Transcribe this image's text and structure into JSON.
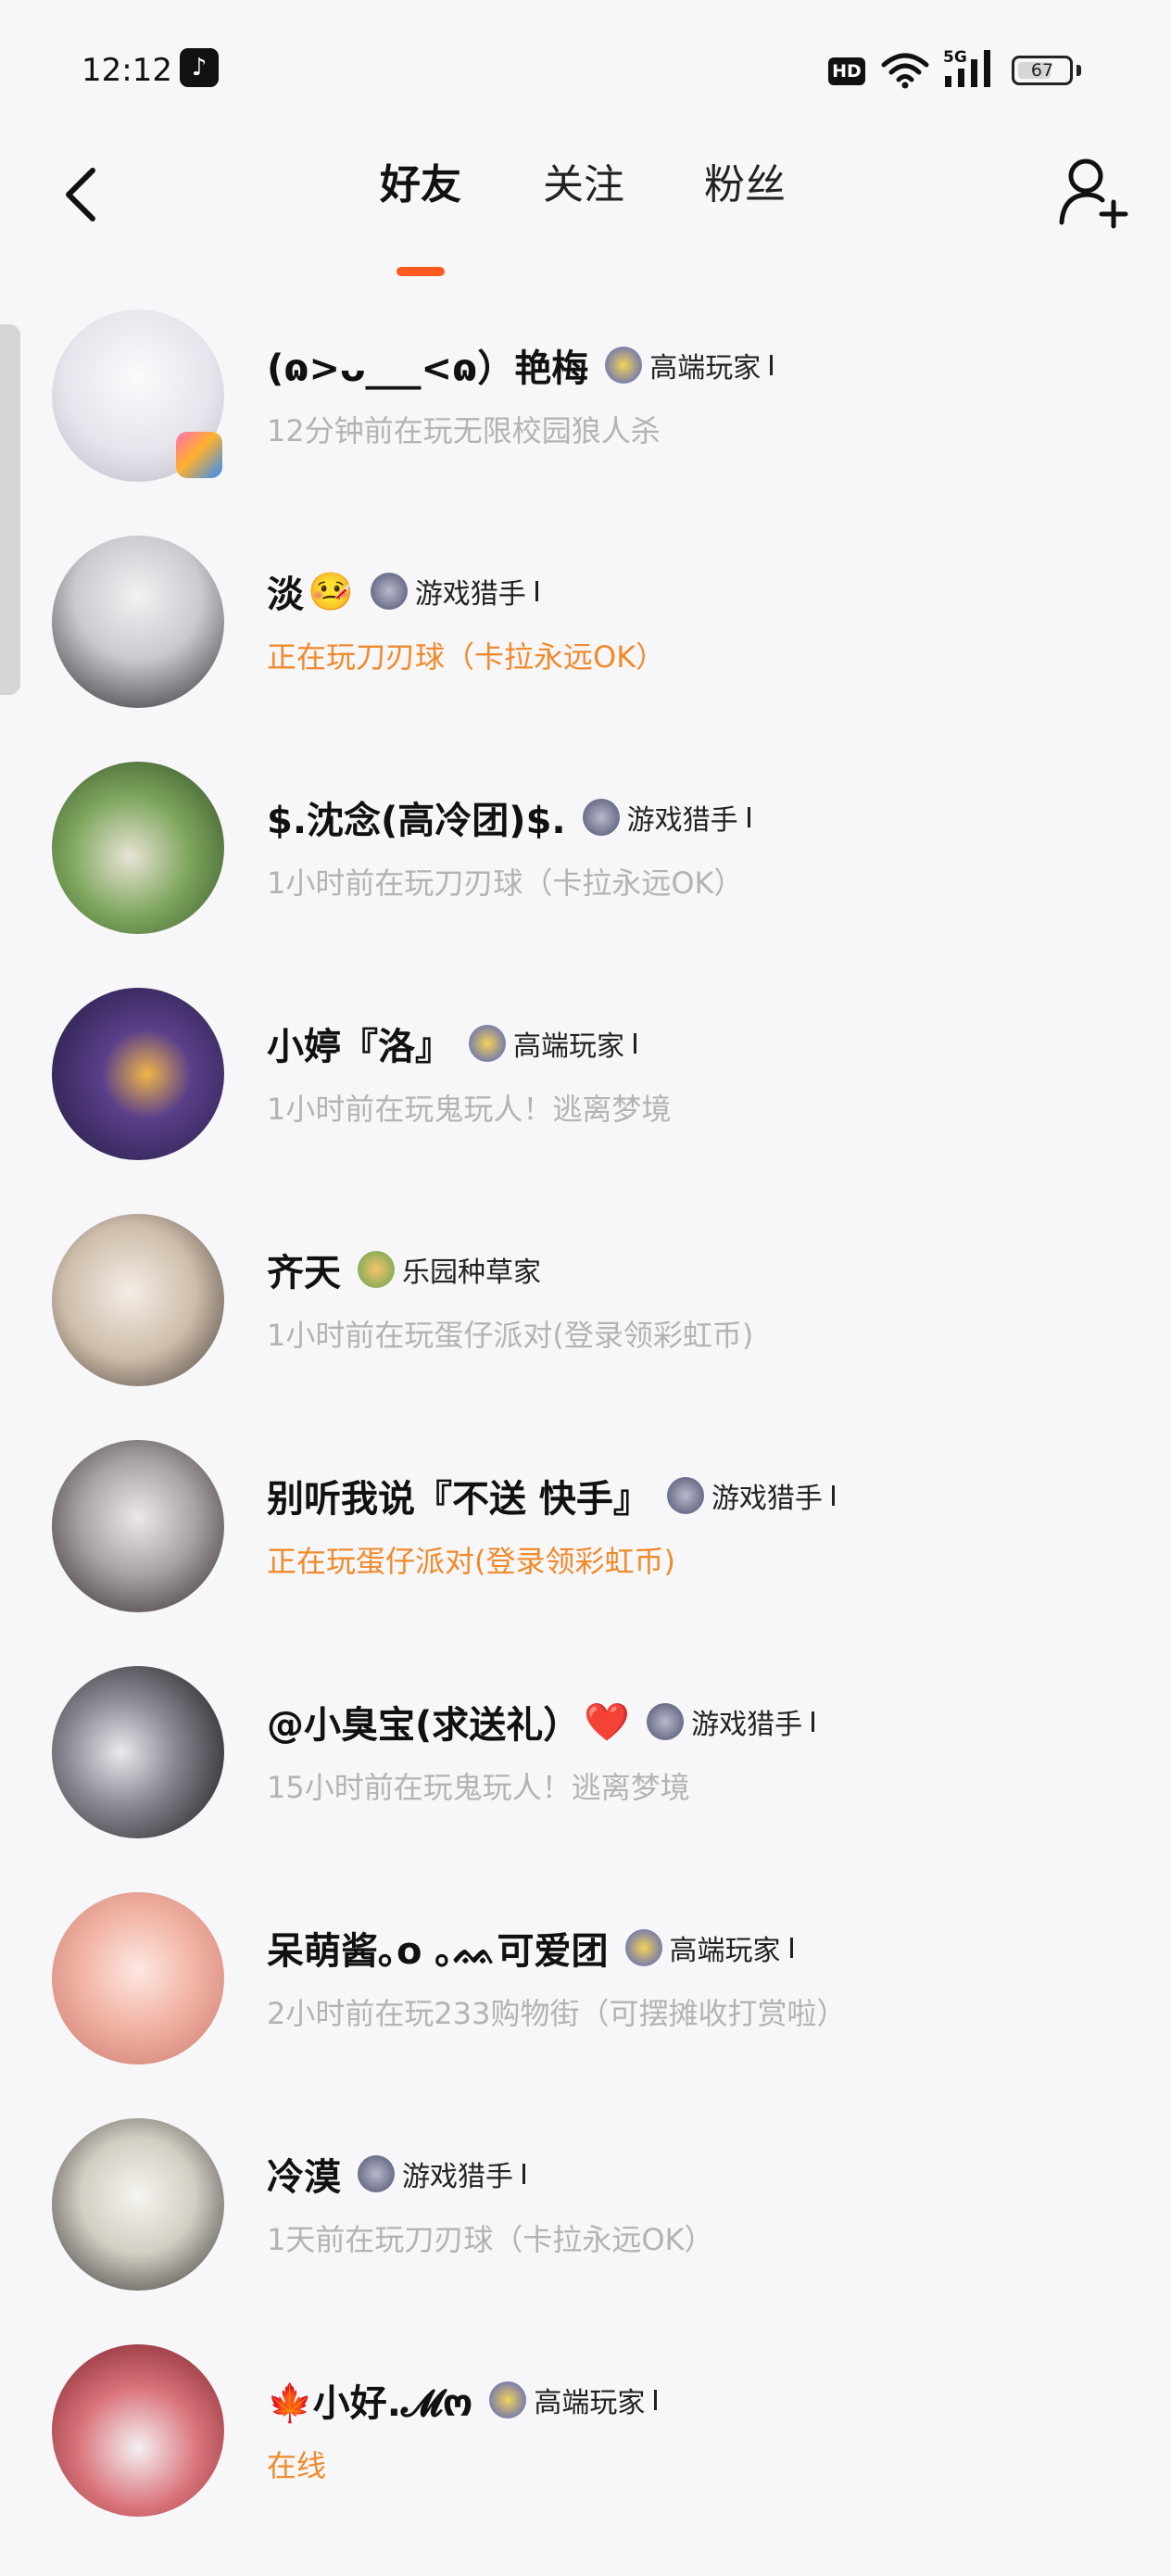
{
  "status_bar": {
    "time": "12:12",
    "hd": "HD",
    "network": "5G",
    "battery": "67",
    "battery_level": 0.67
  },
  "nav": {
    "tabs": [
      {
        "label": "好友",
        "active": true
      },
      {
        "label": "关注",
        "active": false
      },
      {
        "label": "粉丝",
        "active": false
      }
    ]
  },
  "colors": {
    "accent": "#ff5a1f",
    "live_status": "#f08a2a",
    "muted_status": "#b3b3b3"
  },
  "friends": [
    {
      "name": "(ɷ>ᴗ___<ɷ）艳梅",
      "emoji": "",
      "rank_icon": "gold-rank-icon",
      "rank": "高端玩家",
      "status": "12分钟前在玩无限校园狼人杀",
      "live": false
    },
    {
      "name": "淡",
      "emoji": "🤒",
      "rank_icon": "silver-rank-icon",
      "rank": "游戏猎手",
      "status": "正在玩刀刃球（卡拉永远OK）",
      "live": true
    },
    {
      "name": "$.沈念(高冷团)$.",
      "emoji": "",
      "rank_icon": "silver-rank-icon",
      "rank": "游戏猎手",
      "status": "1小时前在玩刀刃球（卡拉永远OK）",
      "live": false
    },
    {
      "name": "小婷『洛』",
      "emoji": "",
      "rank_icon": "gold-rank-icon",
      "rank": "高端玩家",
      "status": "1小时前在玩鬼玩人！逃离梦境",
      "live": false
    },
    {
      "name": "齐天",
      "emoji": "",
      "rank_icon": "garden-rank-icon",
      "rank": "乐园种草家",
      "status": "1小时前在玩蛋仔派对(登录领彩虹币)",
      "live": false
    },
    {
      "name": "别听我说『不送 快手』",
      "emoji": "",
      "rank_icon": "silver-rank-icon",
      "rank": "游戏猎手",
      "status": "正在玩蛋仔派对(登录领彩虹币)",
      "live": true
    },
    {
      "name": "@小臭宝(求送礼）",
      "emoji": "❤️",
      "rank_icon": "silver-rank-icon",
      "rank": "游戏猎手",
      "status": "15小时前在玩鬼玩人！逃离梦境",
      "live": false
    },
    {
      "name": "呆萌酱｡o ｡ᨐ可爱团",
      "emoji": "",
      "rank_icon": "gold-rank-icon",
      "rank": "高端玩家",
      "status": "2小时前在玩233购物街（可摆摊收打赏啦）",
      "live": false
    },
    {
      "name": "冷漠",
      "emoji": "",
      "rank_icon": "silver-rank-icon",
      "rank": "游戏猎手",
      "status": "1天前在玩刀刃球（卡拉永远OK）",
      "live": false
    },
    {
      "name": "🍁小好.𝓜ო",
      "emoji": "",
      "rank_icon": "gold-rank-icon",
      "rank": "高端玩家",
      "status": "在线",
      "live": true
    }
  ]
}
